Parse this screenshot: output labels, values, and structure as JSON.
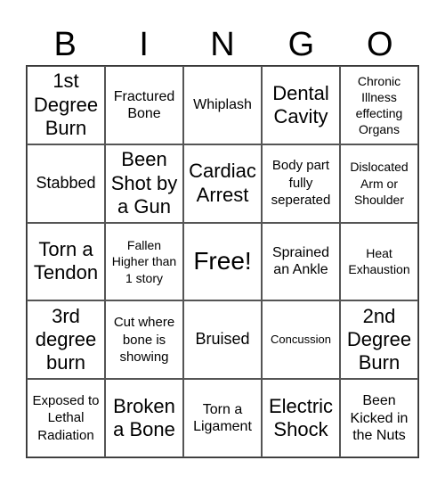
{
  "header": [
    "B",
    "I",
    "N",
    "G",
    "O"
  ],
  "cells": [
    [
      "1st Degree Burn",
      "Fractured Bone",
      "Whiplash",
      "Dental Cavity",
      "Chronic Illness effecting Organs"
    ],
    [
      "Stabbed",
      "Been Shot by a Gun",
      "Cardiac Arrest",
      "Body part fully seperated",
      "Dislocated Arm or Shoulder"
    ],
    [
      "Torn a Tendon",
      "Fallen Higher than 1 story",
      "Free!",
      "Sprained an Ankle",
      "Heat Exhaustion"
    ],
    [
      "3rd degree burn",
      "Cut where bone is showing",
      "Bruised",
      "Concussion",
      "2nd Degree Burn"
    ],
    [
      "Exposed to Lethal Radiation",
      "Broken a Bone",
      "Torn a Ligament",
      "Electric Shock",
      "Been Kicked in the Nuts"
    ]
  ]
}
